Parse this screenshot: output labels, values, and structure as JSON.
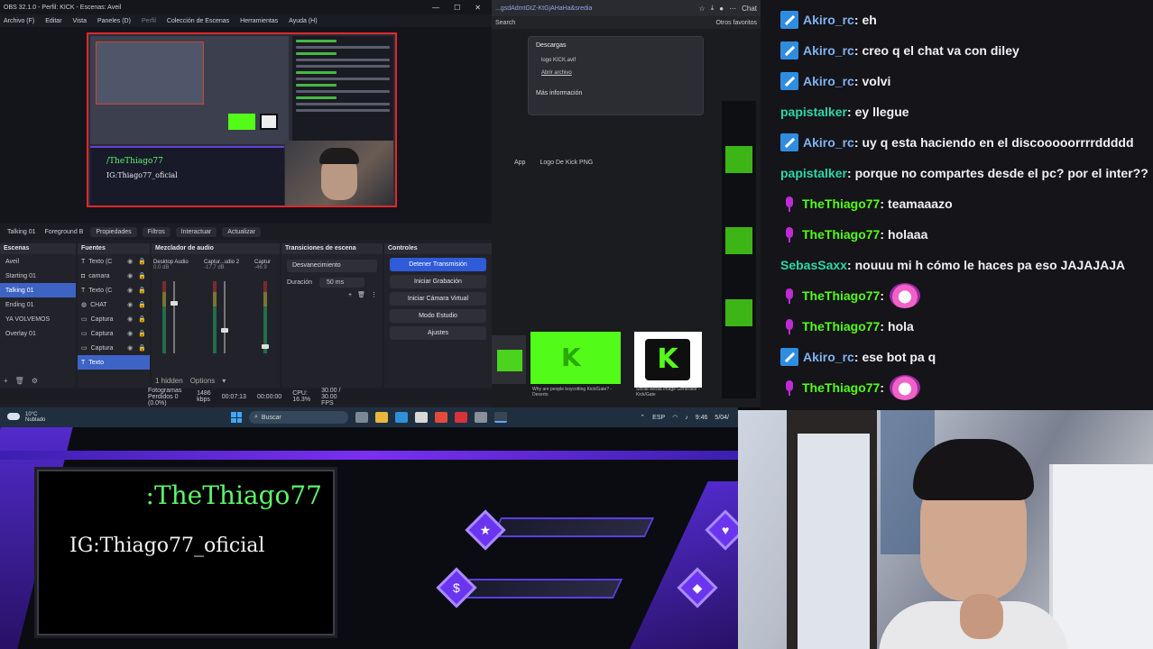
{
  "obs": {
    "title": "OBS 32.1.0 - Perfil: KICK - Escenas: Aveil",
    "menu": [
      "Archivo (F)",
      "Editar",
      "Vista",
      "Paneles (D)",
      "Perfil",
      "Colección de Escenas",
      "Herramientas",
      "Ayuda (H)"
    ],
    "toolbar": {
      "current": "Talking 01",
      "source": "Foreground B",
      "properties": "Propiedades",
      "filters": "Filtros",
      "interact": "Interactuar",
      "refresh": "Actualizar"
    },
    "scenes_title": "Escenas",
    "scenes": [
      "Aveil",
      "Starting 01",
      "Talking 01",
      "Ending 01",
      "YA VOLVEMOS",
      "Overlay 01"
    ],
    "sources_title": "Fuentes",
    "sources": [
      "Texto (C",
      "camara",
      "Texto (C",
      "CHAT",
      "Captura",
      "Captura",
      "Captura",
      "Texto"
    ],
    "mixer_title": "Mezclador de audio",
    "mixer": [
      {
        "name": "Desktop Audio",
        "db": "0.0 dB"
      },
      {
        "name": "Captur...udio 2",
        "db": "-17.7 dB"
      },
      {
        "name": "Captur",
        "db": "-46.9"
      }
    ],
    "mixer_footer": "1 hidden",
    "options_label": "Options",
    "transitions_title": "Transiciones de escena",
    "transition": "Desvanecimiento",
    "duration_label": "Duración",
    "duration_value": "50 ms",
    "controls_title": "Controles",
    "controls": [
      "Detener Transmisión",
      "Iniciar Grabación",
      "Iniciar Cámara Virtual",
      "Modo Estudio",
      "Ajustes"
    ],
    "status": {
      "frames": "Fotogramas Perdidos 0 (0.0%)",
      "bitrate": "1486 kbps",
      "stream_time": "00:07:13",
      "rec_time": "00:00:00",
      "cpu": "CPU: 16.3%",
      "fps": "30.00 / 30.00 FPS"
    }
  },
  "browser": {
    "url": "...gsdAdmtGtZ-KtGjAHaHa&sredia",
    "search_label": "Search",
    "downloads_title": "Descargas",
    "download_file": "logo KICK.avif",
    "download_action": "Abrir archivo",
    "more_info": "Más información",
    "tab_app": "App",
    "search_query": "Logo De Kick PNG",
    "bookmarks": "Otros favoritos",
    "chat_label": "Chat",
    "thumb1_caption": "Why are people boycotting Kick/Gate? - Dexerto",
    "thumb2_caption": "Social Media Image Generator - Kick/Gate"
  },
  "chat": {
    "messages": [
      {
        "badge": "sword",
        "user": "Akiro_rc",
        "color": "#7fb3f0",
        "text": "eh"
      },
      {
        "badge": "sword",
        "user": "Akiro_rc",
        "color": "#7fb3f0",
        "text": "creo q el chat va con diley"
      },
      {
        "badge": "sword",
        "user": "Akiro_rc",
        "color": "#7fb3f0",
        "text": "volvi"
      },
      {
        "badge": "",
        "user": "papistalker",
        "color": "#2ed6a8",
        "text": "ey llegue"
      },
      {
        "badge": "sword",
        "user": "Akiro_rc",
        "color": "#7fb3f0",
        "text": "uy q esta haciendo en el discooooorrrrddddd"
      },
      {
        "badge": "",
        "user": "papistalker",
        "color": "#2ed6a8",
        "text": "porque no compartes desde el pc? por el inter??"
      },
      {
        "badge": "mic",
        "user": "TheThiago77",
        "color": "#53fc18",
        "text": "teamaaazo"
      },
      {
        "badge": "mic",
        "user": "TheThiago77",
        "color": "#53fc18",
        "text": "holaaa"
      },
      {
        "badge": "",
        "user": "SebasSaxx",
        "color": "#2ed6a8",
        "text": "nouuu mi h cómo le haces pa eso JAJAJAJA"
      },
      {
        "badge": "mic",
        "user": "TheThiago77",
        "color": "#53fc18",
        "text": "",
        "emote": true
      },
      {
        "badge": "mic",
        "user": "TheThiago77",
        "color": "#53fc18",
        "text": "hola"
      },
      {
        "badge": "sword",
        "user": "Akiro_rc",
        "color": "#7fb3f0",
        "text": "ese bot pa q"
      },
      {
        "badge": "mic",
        "user": "TheThiago77",
        "color": "#53fc18",
        "text": "",
        "emote": true
      }
    ]
  },
  "taskbar": {
    "temp": "10°C",
    "weather": "Nublado",
    "search": "Buscar",
    "lang": "ESP",
    "time": "9:46",
    "date": "5/04/"
  },
  "overlay": {
    "name": ":TheThiago77",
    "ig": "IG:Thiago77_oficial",
    "preview_name": "/TheThiago77",
    "preview_ig": "IG:Thiago77_oficial"
  }
}
